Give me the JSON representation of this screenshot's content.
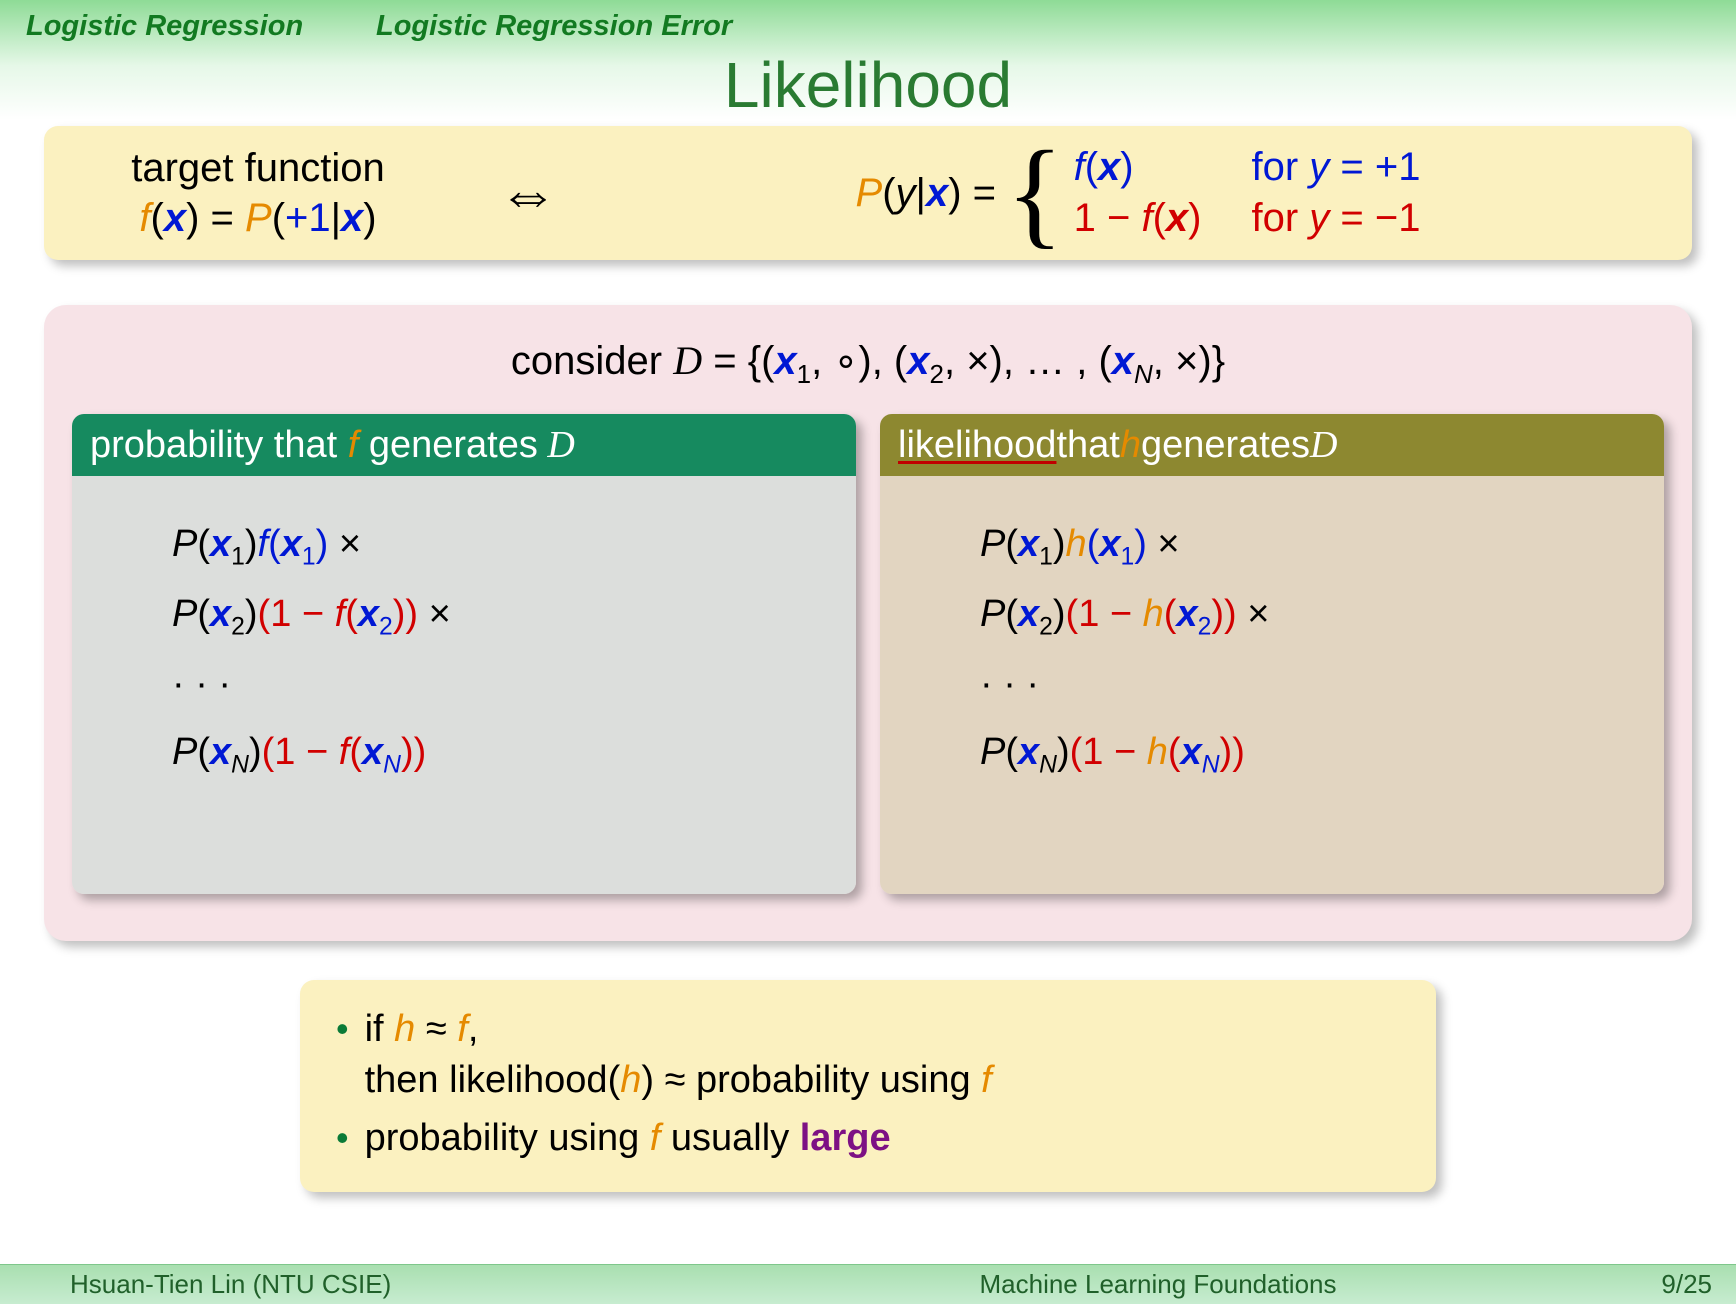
{
  "header": {
    "section": "Logistic Regression",
    "subsection": "Logistic Regression Error"
  },
  "title": "Likelihood",
  "yellowbox": {
    "target_label": "target function",
    "iff": "⇔"
  },
  "pink": {
    "consider_prefix": "consider "
  },
  "leftcard": {
    "title_prefix": "probability that ",
    "title_mid": " generates "
  },
  "rightcard": {
    "title_word": "likelihood",
    "title_mid": " that ",
    "title_suf": " generates "
  },
  "bottom": {
    "b1a": "if ",
    "b1b": ",",
    "b1c": "then likelihood(",
    "b1d": ") ≈ probability using ",
    "b2a": "probability using ",
    "b2b": " usually ",
    "b2c": "large"
  },
  "footer": {
    "left": "Hsuan-Tien Lin  (NTU CSIE)",
    "center": "Machine Learning Foundations",
    "right": "9/25"
  }
}
